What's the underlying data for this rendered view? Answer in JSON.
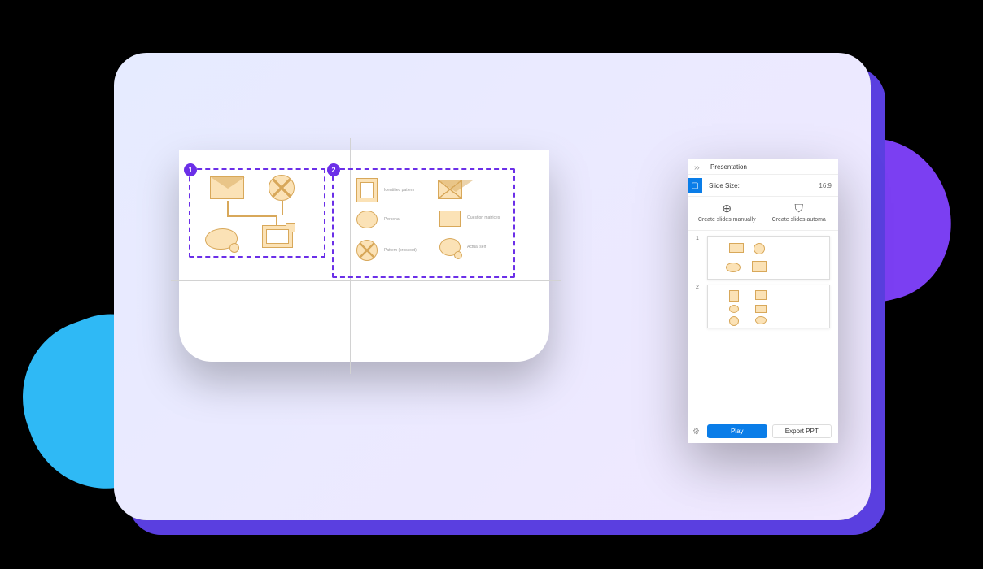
{
  "panel": {
    "title": "Presentation",
    "slide_size_label": "Slide Size:",
    "slide_size_value": "16:9",
    "actions": {
      "manual": "Create slides manually",
      "auto": "Create slides automa"
    },
    "slides": [
      {
        "num": "1"
      },
      {
        "num": "2"
      }
    ],
    "play_label": "Play",
    "export_label": "Export PPT"
  },
  "canvas": {
    "selection_badges": {
      "s1": "1",
      "s2": "2"
    },
    "shape_labels": {
      "r1c1": "Identified pattern",
      "r2c1": "Persona",
      "r3c1": "Pattern (crossout)",
      "r2c2": "Question matrices",
      "r3c2": "Actual self"
    }
  }
}
